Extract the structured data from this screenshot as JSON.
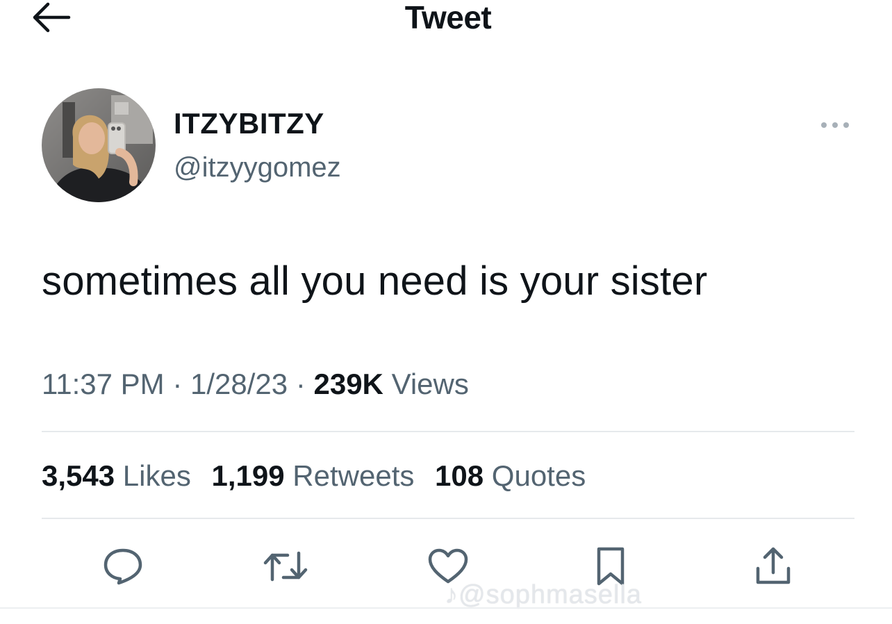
{
  "header": {
    "title": "Tweet",
    "back_icon": "arrow-left-icon"
  },
  "author": {
    "display_name": "ITZYBITZY",
    "handle": "@itzyygomez",
    "avatar": "profile-photo"
  },
  "tweet": {
    "text": "sometimes all you need is your sister",
    "time": "11:37 PM",
    "date": "1/28/23",
    "separator": "·",
    "views_count": "239K",
    "views_label": "Views"
  },
  "stats": {
    "likes_count": "3,543",
    "likes_label": "Likes",
    "retweets_count": "1,199",
    "retweets_label": "Retweets",
    "quotes_count": "108",
    "quotes_label": "Quotes"
  },
  "actions": [
    {
      "name": "reply",
      "icon": "comment-icon"
    },
    {
      "name": "retweet",
      "icon": "retweet-icon"
    },
    {
      "name": "like",
      "icon": "heart-icon"
    },
    {
      "name": "bookmark",
      "icon": "bookmark-icon"
    },
    {
      "name": "share",
      "icon": "share-icon"
    }
  ],
  "watermark": {
    "text": "♪@sophmasella"
  },
  "colors": {
    "text_primary": "#0f1419",
    "text_secondary": "#536471",
    "divider": "#e6e9ec",
    "background": "#ffffff"
  }
}
